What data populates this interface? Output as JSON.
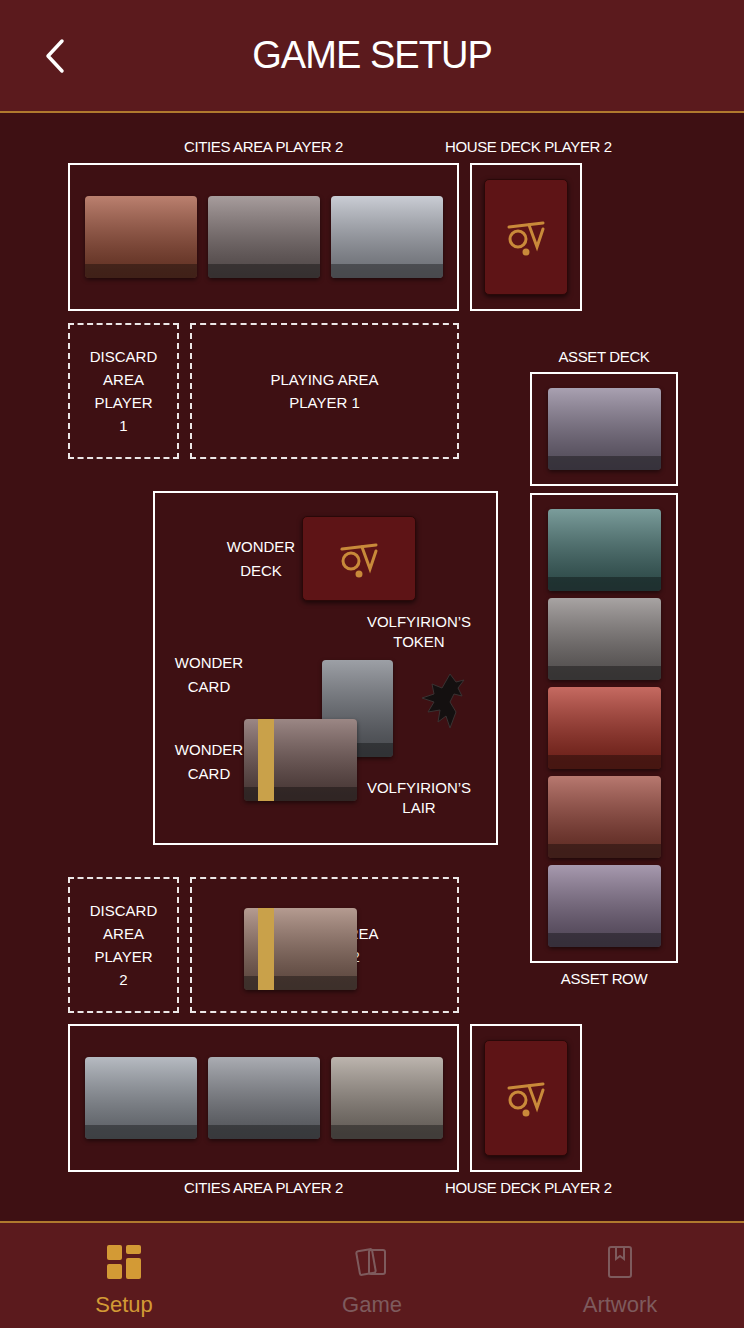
{
  "header": {
    "title": "GAME SETUP"
  },
  "board": {
    "top_cities": {
      "label": "CITIES AREA PLAYER 2",
      "cards": [
        {
          "color": "#a4563f"
        },
        {
          "color": "#8a7c7c"
        },
        {
          "color": "#b8bcc6"
        }
      ]
    },
    "top_house_deck": {
      "label": "HOUSE DECK PLAYER 2"
    },
    "discard_player_1": {
      "label": "DISCARD AREA PLAYER 1"
    },
    "playing_player_1": {
      "label": "PLAYING AREA PLAYER 1"
    },
    "wonder_deck": {
      "label": "WONDER DECK"
    },
    "wonder_cards": [
      {
        "label": "WONDER CARD",
        "color": "#7a5f5c"
      },
      {
        "label": "WONDER CARD",
        "color": "#9c7a6c"
      }
    ],
    "token": {
      "label": "VOLFYIRION’S TOKEN"
    },
    "lair": {
      "label": "VOLFYIRION’S LAIR",
      "color": "#7c8088"
    },
    "asset_deck": {
      "label": "ASSET DECK",
      "color": "#8c8197"
    },
    "asset_row": {
      "label": "ASSET ROW",
      "cards": [
        {
          "color": "#4f7c7a"
        },
        {
          "color": "#8b8584"
        },
        {
          "color": "#b3392d"
        },
        {
          "color": "#a04c40"
        },
        {
          "color": "#8a7894"
        }
      ]
    },
    "discard_player_2": {
      "label": "DISCARD AREA PLAYER 2"
    },
    "playing_player_2": {
      "label": "PLAYING AREA PLAYER 2"
    },
    "bottom_cities": {
      "label": "CITIES AREA PLAYER 2",
      "cards": [
        {
          "color": "#9ea4ad"
        },
        {
          "color": "#8e9199"
        },
        {
          "color": "#a69c93"
        }
      ]
    },
    "bottom_house_deck": {
      "label": "HOUSE DECK PLAYER 2"
    }
  },
  "nav": [
    {
      "label": "Setup",
      "selected": true
    },
    {
      "label": "Game",
      "selected": false
    },
    {
      "label": "Artwork",
      "selected": false
    }
  ]
}
